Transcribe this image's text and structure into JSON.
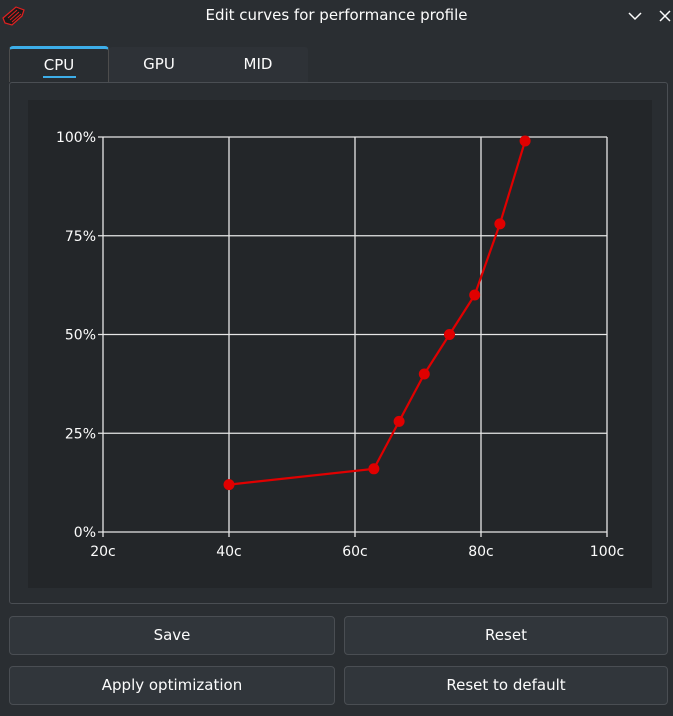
{
  "window": {
    "title": "Edit curves for performance profile"
  },
  "tabs": [
    {
      "label": "CPU",
      "selected": true
    },
    {
      "label": "GPU",
      "selected": false
    },
    {
      "label": "MID",
      "selected": false
    }
  ],
  "buttons": {
    "save": "Save",
    "reset": "Reset",
    "apply": "Apply optimization",
    "reset_default": "Reset to default"
  },
  "colors": {
    "accent": "#3daee9",
    "curve": "#e00000",
    "grid": "#e6e6e6"
  },
  "chart_data": {
    "type": "line",
    "x_ticks": [
      "20c",
      "40c",
      "60c",
      "80c",
      "100c"
    ],
    "y_ticks": [
      "0%",
      "25%",
      "50%",
      "75%",
      "100%"
    ],
    "xlim": [
      20,
      100
    ],
    "ylim": [
      0,
      100
    ],
    "grid": true,
    "series": [
      {
        "x": [
          40,
          63,
          67,
          71,
          75,
          79,
          83,
          87
        ],
        "y": [
          12,
          16,
          28,
          40,
          50,
          60,
          78,
          99
        ]
      }
    ]
  }
}
